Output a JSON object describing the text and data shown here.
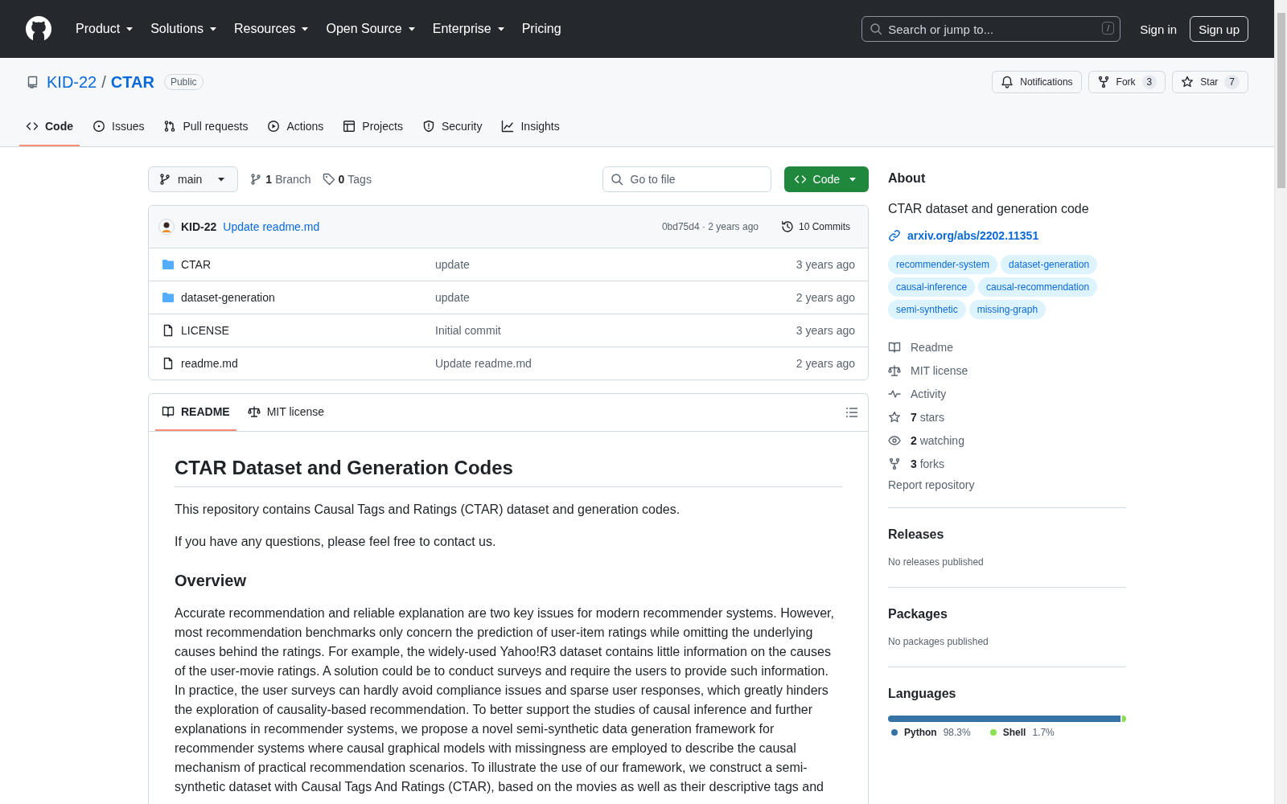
{
  "header": {
    "nav": [
      {
        "label": "Product",
        "has_menu": true
      },
      {
        "label": "Solutions",
        "has_menu": true
      },
      {
        "label": "Resources",
        "has_menu": true
      },
      {
        "label": "Open Source",
        "has_menu": true
      },
      {
        "label": "Enterprise",
        "has_menu": true
      },
      {
        "label": "Pricing",
        "has_menu": false
      }
    ],
    "search": {
      "placeholder": "Search or jump to...",
      "shortcut": "/"
    },
    "sign_in": "Sign in",
    "sign_up": "Sign up"
  },
  "repo": {
    "owner": "KID-22",
    "separator": "/",
    "name": "CTAR",
    "visibility": "Public",
    "actions": [
      {
        "kind": "bell",
        "label": "Notifications"
      },
      {
        "kind": "fork",
        "label": "Fork",
        "count": "3"
      },
      {
        "kind": "star",
        "label": "Star",
        "count": "7"
      }
    ],
    "tabs": [
      {
        "kind": "code",
        "label": "Code",
        "selected": true
      },
      {
        "kind": "issue",
        "label": "Issues",
        "selected": false
      },
      {
        "kind": "pull",
        "label": "Pull requests",
        "selected": false
      },
      {
        "kind": "play",
        "label": "Actions",
        "selected": false
      },
      {
        "kind": "table",
        "label": "Projects",
        "selected": false
      },
      {
        "kind": "shield",
        "label": "Security",
        "selected": false
      },
      {
        "kind": "graph",
        "label": "Insights",
        "selected": false
      }
    ]
  },
  "toolbar": {
    "branch": "main",
    "branch_count": "1",
    "branch_label": "Branch",
    "tag_count": "0",
    "tag_label": "Tags",
    "file_search": {
      "placeholder": "Go to file"
    },
    "code_button": "Code"
  },
  "latest_commit": {
    "author": "KID-22",
    "message": "Update readme.md",
    "hash_age": "0bd75d4 · 2 years ago",
    "commits": "10 Commits"
  },
  "files": [
    {
      "kind": "folder",
      "name": "CTAR",
      "message": "update",
      "age": "3 years ago"
    },
    {
      "kind": "folder",
      "name": "dataset-generation",
      "message": "update",
      "age": "2 years ago"
    },
    {
      "kind": "file",
      "name": "LICENSE",
      "message": "Initial commit",
      "age": "3 years ago"
    },
    {
      "kind": "file",
      "name": "readme.md",
      "message": "Update readme.md",
      "age": "2 years ago"
    }
  ],
  "readme": {
    "tabs": [
      {
        "kind": "book",
        "label": "README",
        "selected": true
      },
      {
        "kind": "scale",
        "label": "MIT license",
        "selected": false
      }
    ],
    "title": "CTAR Dataset and Generation Codes",
    "blocks": [
      {
        "kind": "p",
        "text": "This repository contains Causal Tags and Ratings (CTAR) dataset and generation codes."
      },
      {
        "kind": "p",
        "text": "If you have any questions, please feel free to contact us."
      },
      {
        "kind": "h2",
        "text": "Overview"
      },
      {
        "kind": "p",
        "text": "Accurate recommendation and reliable explanation are two key issues for modern recommender systems. However, most recommendation benchmarks only concern the prediction of user-item ratings while omitting the underlying causes behind the ratings. For example, the widely-used Yahoo!R3 dataset contains little information on the causes of the user-movie ratings. A solution could be to conduct surveys and require the users to provide such information. In practice, the user surveys can hardly avoid compliance issues and sparse user responses, which greatly hinders the exploration of causality-based recommendation. To better support the studies of causal inference and further explanations in recommender systems, we propose a novel semi-synthetic data generation framework for recommender systems where causal graphical models with missingness are employed to describe the causal mechanism of practical recommendation scenarios. To illustrate the use of our framework, we construct a semi-synthetic dataset with Causal Tags And Ratings (CTAR), based on the movies as well as their descriptive tags and"
      }
    ]
  },
  "about": {
    "title": "About",
    "description": "CTAR dataset and generation code",
    "link": "arxiv.org/abs/2202.11351",
    "topics": [
      "recommender-system",
      "dataset-generation",
      "causal-inference",
      "causal-recommendation",
      "semi-synthetic",
      "missing-graph"
    ],
    "stats": [
      {
        "kind": "book",
        "label": "Readme"
      },
      {
        "kind": "scale",
        "label": "MIT license"
      },
      {
        "kind": "pulse",
        "label": "Activity"
      },
      {
        "kind": "star",
        "count": "7",
        "label": "stars"
      },
      {
        "kind": "eye",
        "count": "2",
        "label": "watching"
      },
      {
        "kind": "fork",
        "count": "3",
        "label": "forks"
      }
    ],
    "report": "Report repository"
  },
  "releases": {
    "title": "Releases",
    "note": "No releases published"
  },
  "packages": {
    "title": "Packages",
    "note": "No packages published"
  },
  "languages": {
    "title": "Languages",
    "items": [
      {
        "name": "Python",
        "percent": "98.3%",
        "color": "#3572a5",
        "level": 0.983
      },
      {
        "name": "Shell",
        "percent": "1.7%",
        "color": "#89e051",
        "level": 0.017
      }
    ]
  }
}
